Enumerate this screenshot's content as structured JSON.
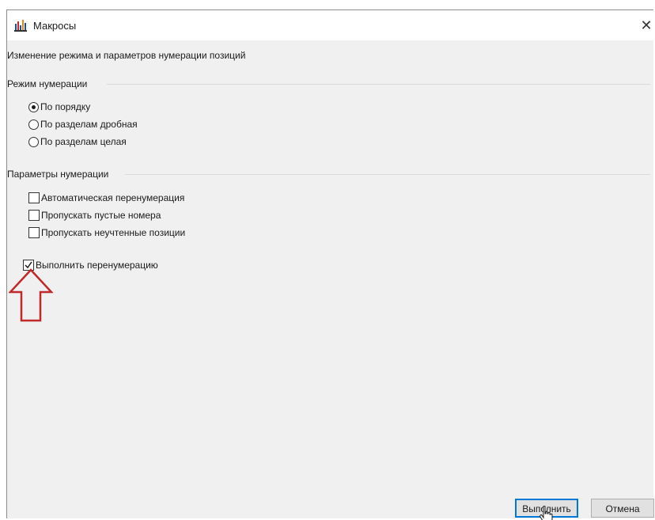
{
  "window": {
    "title": "Макросы",
    "close_glyph": "✕"
  },
  "caption": "Изменение режима и параметров нумерации позиций",
  "numbering_mode": {
    "label": "Режим нумерации",
    "options": [
      {
        "label": "По порядку",
        "checked": true
      },
      {
        "label": "По разделам дробная",
        "checked": false
      },
      {
        "label": "По разделам целая",
        "checked": false
      }
    ]
  },
  "numbering_params": {
    "label": "Параметры нумерации",
    "options": [
      {
        "label": "Автоматическая перенумерация",
        "checked": false
      },
      {
        "label": "Пропускать пустые номера",
        "checked": false
      },
      {
        "label": "Пропускать неучтенные позиции",
        "checked": false
      }
    ]
  },
  "renumber": {
    "label": "Выполнить перенумерацию",
    "checked": true
  },
  "buttons": {
    "run": "Выполнить",
    "cancel": "Отмена"
  },
  "colors": {
    "accent": "#0078d7",
    "annotation_arrow": "#c0282a"
  }
}
